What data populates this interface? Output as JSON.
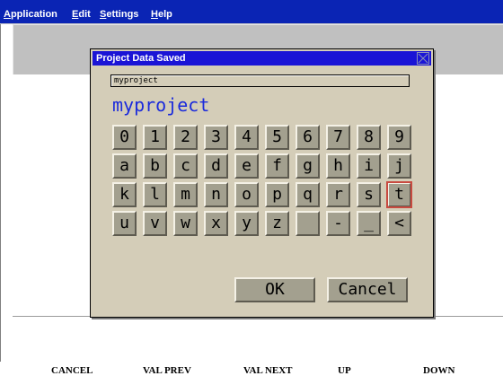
{
  "menu": {
    "items": [
      {
        "label": "Application",
        "accel": "A"
      },
      {
        "label": "Edit",
        "accel": "E"
      },
      {
        "label": "Settings",
        "accel": "S"
      },
      {
        "label": "Help",
        "accel": "H"
      }
    ]
  },
  "dialog": {
    "title": "Project Data Saved",
    "close_icon": "close-x-icon",
    "field_value": "myproject",
    "big_text": "myproject",
    "keyboard": {
      "rows": [
        [
          "0",
          "1",
          "2",
          "3",
          "4",
          "5",
          "6",
          "7",
          "8",
          "9"
        ],
        [
          "a",
          "b",
          "c",
          "d",
          "e",
          "f",
          "g",
          "h",
          "i",
          "j"
        ],
        [
          "k",
          "l",
          "m",
          "n",
          "o",
          "p",
          "q",
          "r",
          "s",
          "t"
        ],
        [
          "u",
          "v",
          "w",
          "x",
          "y",
          "z",
          "",
          "-",
          "_",
          "<"
        ]
      ],
      "highlighted_key": "t",
      "highlight_color": "#c84a40"
    },
    "ok_label": "OK",
    "cancel_label": "Cancel"
  },
  "function_keys": [
    {
      "label": "CANCEL"
    },
    {
      "label": "VAL PREV"
    },
    {
      "label": "VAL NEXT"
    },
    {
      "label": "UP"
    },
    {
      "label": "DOWN"
    }
  ],
  "colors": {
    "menubar": "#0a24b4",
    "titlebar": "#1a14d6",
    "dialog_bg": "#d4cdb8",
    "key_bg": "#a3a08f",
    "big_text": "#1a2adc"
  }
}
